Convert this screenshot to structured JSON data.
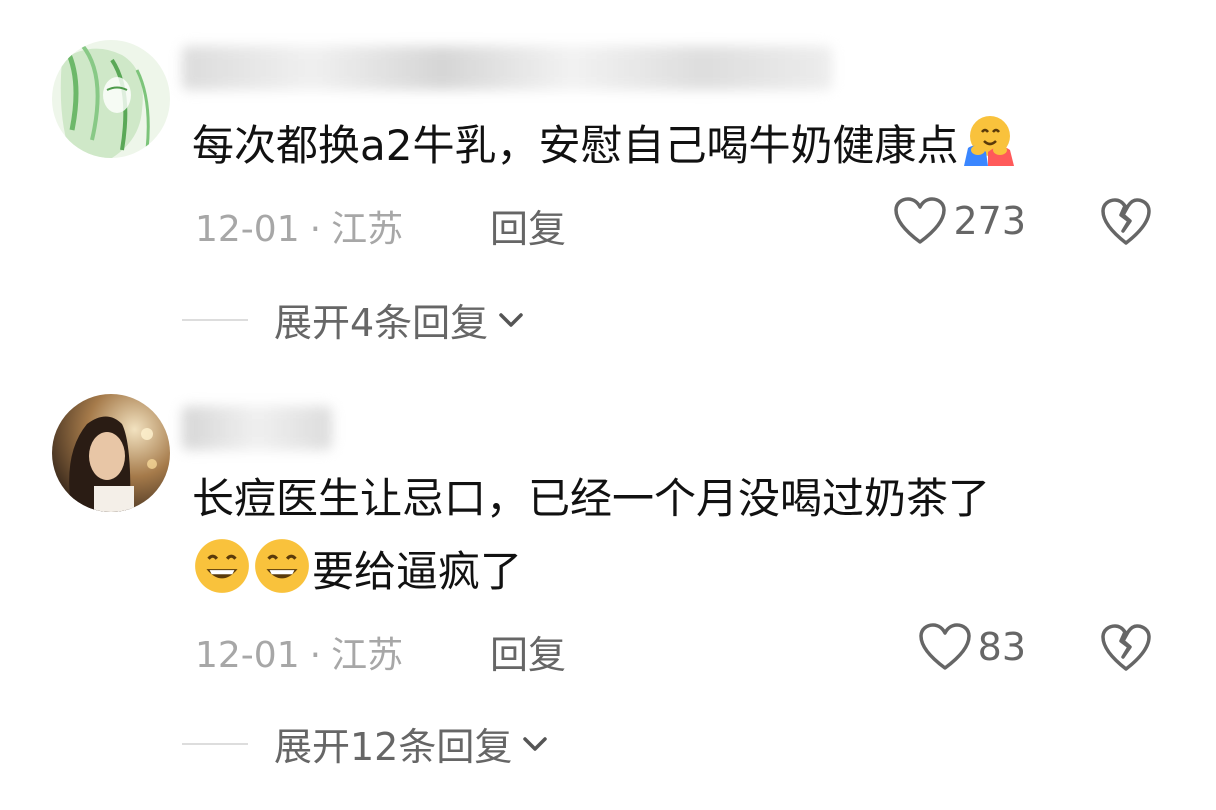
{
  "comments": [
    {
      "text": "每次都换a2牛乳，安慰自己喝牛奶健康点",
      "emoji_after": "hugging-face-icon",
      "date": "12-01",
      "separator": "·",
      "location": "江苏",
      "reply_label": "回复",
      "likes": "273",
      "expand_label": "展开4条回复"
    },
    {
      "text_line1": "长痘医生让忌口，已经一个月没喝过奶茶了",
      "text_line2": "要给逼疯了",
      "emoji_before_line2": [
        "grinning-face-icon",
        "grinning-face-icon"
      ],
      "date": "12-01",
      "separator": "·",
      "location": "江苏",
      "reply_label": "回复",
      "likes": "83",
      "expand_label": "展开12条回复"
    }
  ],
  "colors": {
    "text": "#111111",
    "meta": "#a7a7a7",
    "action": "#666666",
    "divider": "#dddddd",
    "avatar1_tint": "#7cc47a",
    "emoji_yellow": "#f9c23c"
  }
}
